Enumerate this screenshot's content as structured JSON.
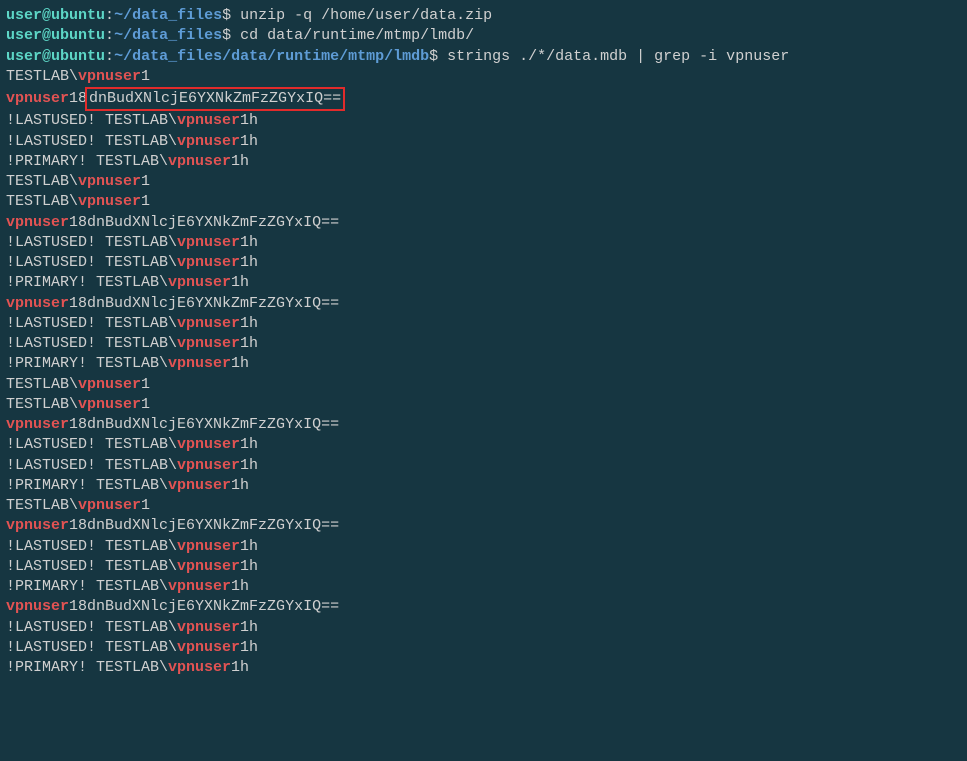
{
  "prompt": {
    "user": "user",
    "host": "ubuntu",
    "path1": "~/data_files",
    "path2": "~/data_files",
    "path3": "~/data_files/data/runtime/mtmp/lmdb"
  },
  "commands": {
    "c1": "unzip -q /home/user/data.zip",
    "c2": "cd data/runtime/mtmp/lmdb/",
    "c3": "strings ./*/data.mdb | grep -i vpnuser"
  },
  "match": "vpnuser",
  "b64": "dnBudXNlcjE6YXNkZmFzZGYxIQ==",
  "prefix_testlab": "TESTLAB\\",
  "suffix_1": "1",
  "suffix_1h": "1h",
  "vpnuser18": "18",
  "lastused": "!LASTUSED! TESTLAB\\",
  "primary": "!PRIMARY! TESTLAB\\"
}
